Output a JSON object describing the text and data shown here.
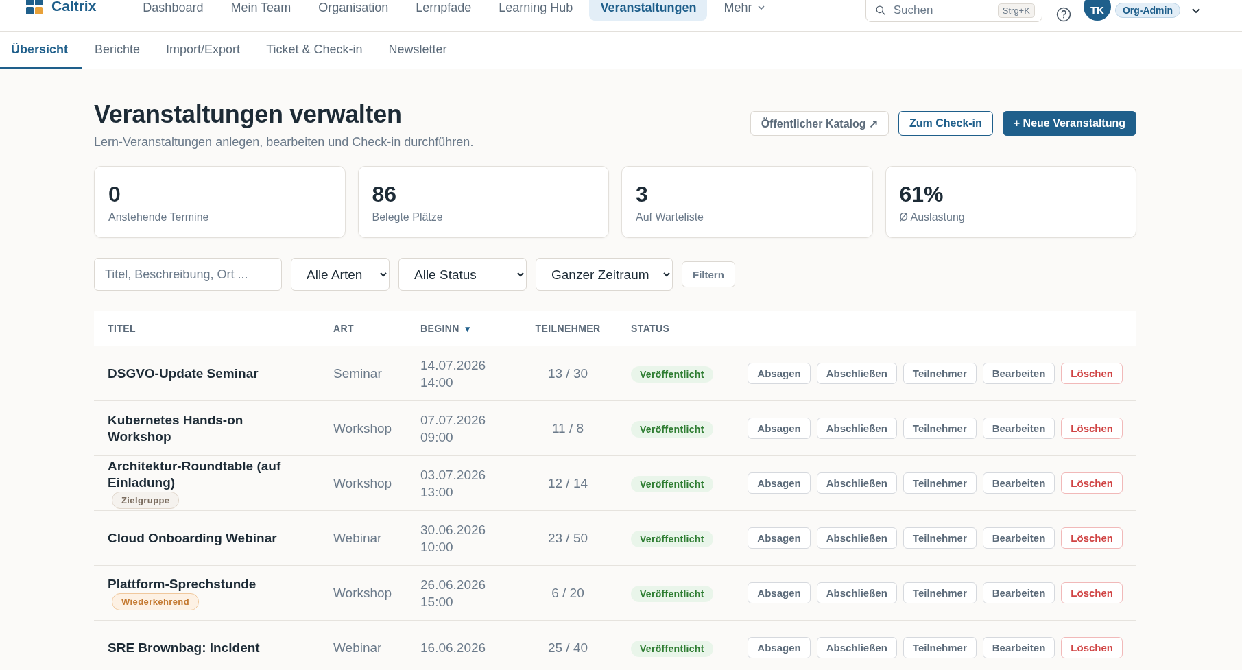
{
  "topnav": {
    "brand": "Caltrix",
    "items": [
      {
        "label": "Dashboard",
        "selected": false,
        "kind": "link"
      },
      {
        "label": "Mein Team",
        "selected": false,
        "kind": "link"
      },
      {
        "label": "Organisation",
        "selected": false,
        "kind": "link"
      },
      {
        "label": "Lernpfade",
        "selected": false,
        "kind": "link"
      },
      {
        "label": "Learning Hub",
        "selected": false,
        "kind": "link"
      },
      {
        "label": "Veranstaltungen",
        "selected": true,
        "kind": "link"
      },
      {
        "label": "Mehr",
        "selected": false,
        "kind": "menu"
      }
    ],
    "search": {
      "placeholder": "Suchen",
      "shortcut": "Strg+K"
    },
    "user": {
      "initials": "TK",
      "role": "Org-Admin"
    }
  },
  "subtabs": [
    {
      "label": "Übersicht",
      "selected": true
    },
    {
      "label": "Berichte",
      "selected": false
    },
    {
      "label": "Import/Export",
      "selected": false
    },
    {
      "label": "Ticket & Check-in",
      "selected": false
    },
    {
      "label": "Newsletter",
      "selected": false
    }
  ],
  "page": {
    "title": "Veranstaltungen verwalten",
    "subtitle": "Lern-Veranstaltungen anlegen, bearbeiten und Check-in durchführen.",
    "actions": [
      {
        "label": "Öffentlicher Katalog ↗",
        "kind": "secondary"
      },
      {
        "label": "Zum Check-in",
        "kind": "outline"
      },
      {
        "label": "+ Neue Veranstaltung",
        "kind": "primary"
      }
    ]
  },
  "stats": [
    {
      "value": "0",
      "label": "Anstehende Termine"
    },
    {
      "value": "86",
      "label": "Belegte Plätze"
    },
    {
      "value": "3",
      "label": "Auf Warteliste"
    },
    {
      "value": "61%",
      "label": "Ø Auslastung"
    }
  ],
  "filters": {
    "search": {
      "placeholder": "Titel, Beschreibung, Ort ..."
    },
    "selects": [
      {
        "value": "Alle Arten"
      },
      {
        "value": "Alle Status"
      },
      {
        "value": "Ganzer Zeitraum"
      }
    ],
    "button": "Filtern"
  },
  "table": {
    "columns": [
      {
        "label": "TITEL"
      },
      {
        "label": "ART"
      },
      {
        "label": "BEGINN",
        "sort_indicator": "▼"
      },
      {
        "label": "TEILNEHMER"
      },
      {
        "label": "STATUS"
      }
    ],
    "rows": [
      {
        "title": "DSGVO-Update Seminar",
        "art": "Seminar",
        "date": "14.07.2026",
        "time": "14:00",
        "participants": "13 / 30",
        "status": "Veröffentlicht",
        "actions": [
          {
            "label": "Absagen",
            "kind": "normal"
          },
          {
            "label": "Abschließen",
            "kind": "normal"
          },
          {
            "label": "Teilnehmer",
            "kind": "normal"
          },
          {
            "label": "Bearbeiten",
            "kind": "normal"
          },
          {
            "label": "Löschen",
            "kind": "danger"
          }
        ]
      },
      {
        "title": "Kubernetes Hands-on Workshop",
        "art": "Workshop",
        "date": "07.07.2026",
        "time": "09:00",
        "participants": "11 / 8",
        "status": "Veröffentlicht",
        "actions": [
          {
            "label": "Absagen",
            "kind": "normal"
          },
          {
            "label": "Abschließen",
            "kind": "normal"
          },
          {
            "label": "Teilnehmer",
            "kind": "normal"
          },
          {
            "label": "Bearbeiten",
            "kind": "normal"
          },
          {
            "label": "Löschen",
            "kind": "danger"
          }
        ]
      },
      {
        "title": "Architektur-Roundtable (auf Einladung)",
        "tag": {
          "label": "Zielgruppe",
          "kind": "audience"
        },
        "art": "Workshop",
        "date": "03.07.2026",
        "time": "13:00",
        "participants": "12 / 14",
        "status": "Veröffentlicht",
        "actions": [
          {
            "label": "Absagen",
            "kind": "normal"
          },
          {
            "label": "Abschließen",
            "kind": "normal"
          },
          {
            "label": "Teilnehmer",
            "kind": "normal"
          },
          {
            "label": "Bearbeiten",
            "kind": "normal"
          },
          {
            "label": "Löschen",
            "kind": "danger"
          }
        ]
      },
      {
        "title": "Cloud Onboarding Webinar",
        "art": "Webinar",
        "date": "30.06.2026",
        "time": "10:00",
        "participants": "23 / 50",
        "status": "Veröffentlicht",
        "actions": [
          {
            "label": "Absagen",
            "kind": "normal"
          },
          {
            "label": "Abschließen",
            "kind": "normal"
          },
          {
            "label": "Teilnehmer",
            "kind": "normal"
          },
          {
            "label": "Bearbeiten",
            "kind": "normal"
          },
          {
            "label": "Löschen",
            "kind": "danger"
          }
        ]
      },
      {
        "title": "Plattform-Sprechstunde",
        "tag": {
          "label": "Wiederkehrend",
          "kind": "recurring"
        },
        "art": "Workshop",
        "date": "26.06.2026",
        "time": "15:00",
        "participants": "6 / 20",
        "status": "Veröffentlicht",
        "actions": [
          {
            "label": "Absagen",
            "kind": "normal"
          },
          {
            "label": "Abschließen",
            "kind": "normal"
          },
          {
            "label": "Teilnehmer",
            "kind": "normal"
          },
          {
            "label": "Bearbeiten",
            "kind": "normal"
          },
          {
            "label": "Löschen",
            "kind": "danger"
          }
        ]
      },
      {
        "title": "SRE Brownbag: Incident",
        "art": "Webinar",
        "date": "16.06.2026",
        "participants": "25 / 40",
        "status": "Veröffentlicht",
        "actions": [
          {
            "label": "Absagen",
            "kind": "normal"
          },
          {
            "label": "Abschließen",
            "kind": "normal"
          },
          {
            "label": "Teilnehmer",
            "kind": "normal"
          },
          {
            "label": "Bearbeiten",
            "kind": "normal"
          },
          {
            "label": "Löschen",
            "kind": "danger"
          }
        ]
      }
    ]
  }
}
